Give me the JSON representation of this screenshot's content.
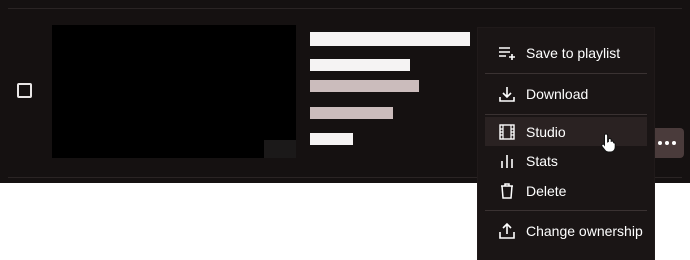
{
  "menu": {
    "items": [
      {
        "key": "save",
        "label": "Save to playlist",
        "icon": "playlist-add-icon"
      },
      {
        "key": "download",
        "label": "Download",
        "icon": "download-icon"
      },
      {
        "key": "studio",
        "label": "Studio",
        "icon": "film-icon"
      },
      {
        "key": "stats",
        "label": "Stats",
        "icon": "bar-chart-icon"
      },
      {
        "key": "delete",
        "label": "Delete",
        "icon": "trash-icon"
      },
      {
        "key": "ownership",
        "label": "Change ownership",
        "icon": "share-upload-icon"
      }
    ]
  },
  "colors": {
    "panel_bg": "#151111",
    "menu_bg": "#1a1515",
    "hover_bg": "#2a2222",
    "more_button_bg": "#4a3b3b",
    "text": "#ffffff"
  }
}
